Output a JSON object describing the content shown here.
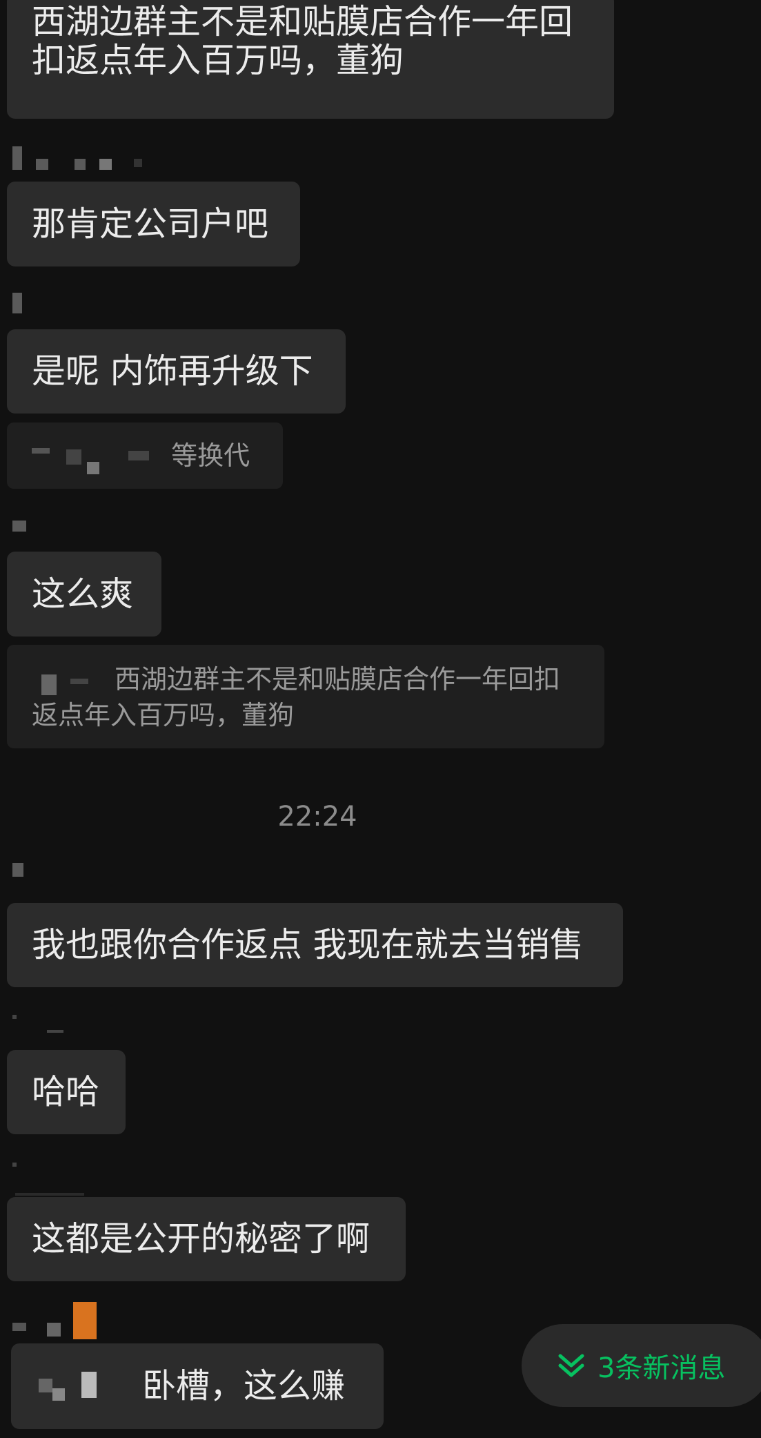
{
  "messages": [
    {
      "text": "西湖边群主不是和贴膜店合作一年回扣返点年入百万吗，董狗"
    },
    {
      "text": "那肯定公司户吧"
    },
    {
      "text": "是呢 内饰再升级下"
    },
    {
      "text": "这么爽"
    },
    {
      "text": "我也跟你合作返点 我现在就去当销售"
    },
    {
      "text": "哈哈"
    },
    {
      "text": "这都是公开的秘密了啊"
    },
    {
      "text": "卧槽，这么赚"
    }
  ],
  "quotes": [
    {
      "text": "等换代"
    },
    {
      "text": "西湖边群主不是和贴膜店合作一年回扣返点年入百万吗，董狗"
    }
  ],
  "timestamp": "22:24",
  "new_messages_pill": {
    "label": "3条新消息",
    "icon": "double-chevron-down-icon"
  },
  "colors": {
    "background": "#111111",
    "bubble": "#2c2c2c",
    "quote": "#1f1f1f",
    "accent": "#07c160"
  }
}
